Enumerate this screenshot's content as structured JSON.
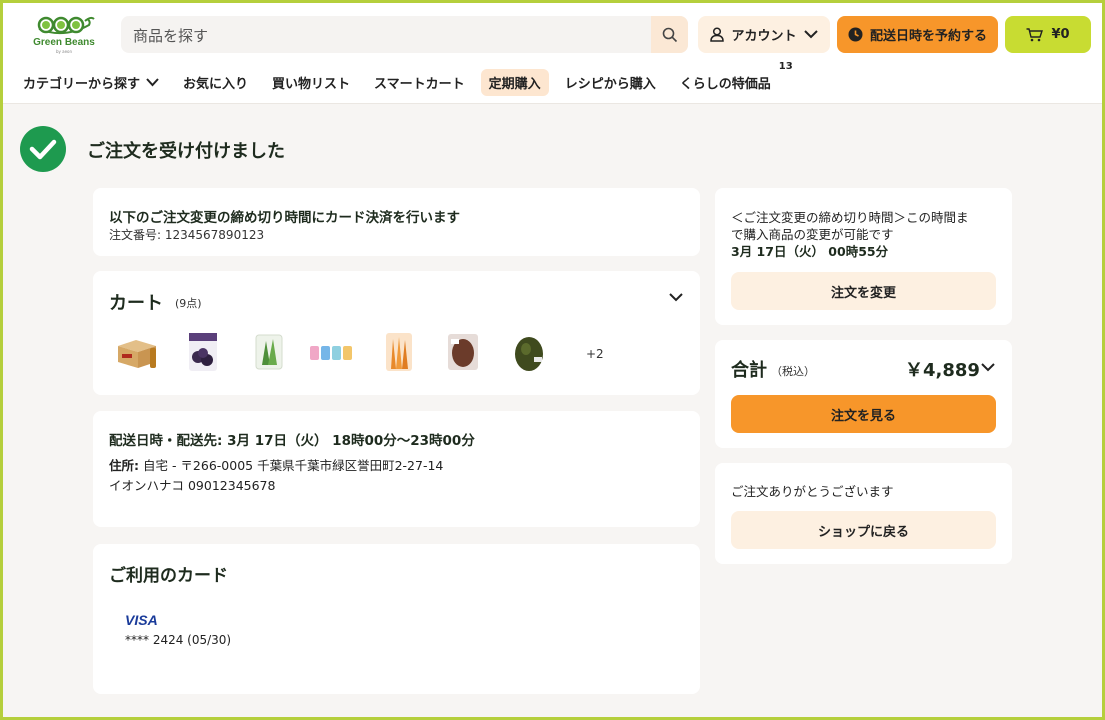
{
  "brand": {
    "name": "Green Beans",
    "sub": "by aeon"
  },
  "search": {
    "placeholder": "商品を探す"
  },
  "header": {
    "account_label": "アカウント",
    "reserve_label": "配送日時を予約する",
    "cart_total": "¥0"
  },
  "nav": {
    "items": [
      {
        "label": "カテゴリーから探す"
      },
      {
        "label": "お気に入り"
      },
      {
        "label": "買い物リスト"
      },
      {
        "label": "スマートカート"
      },
      {
        "label": "定期購入"
      },
      {
        "label": "レシピから購入"
      },
      {
        "label": "くらしの特価品",
        "badge": "13"
      }
    ]
  },
  "confirmation": {
    "title": "ご注文を受け付けました"
  },
  "notice": {
    "headline": "以下のご注文変更の締め切り時間にカード決済を行います",
    "order_number": "注文番号: 1234567890123"
  },
  "cart": {
    "title": "カート",
    "count": "(9点)",
    "more": "+2",
    "items": [
      {
        "icon": "beverage-box-icon"
      },
      {
        "icon": "snack-bag-icon"
      },
      {
        "icon": "vegetable-pack-icon"
      },
      {
        "icon": "soap-bars-icon"
      },
      {
        "icon": "carrot-bag-icon"
      },
      {
        "icon": "chocolate-pack-icon"
      },
      {
        "icon": "avocado-icon"
      }
    ]
  },
  "delivery": {
    "headline": "配送日時・配送先: 3月 17日（火） 18時00分〜23時00分",
    "address_label": "住所:",
    "address": " 自宅 - 〒266-0005 千葉県千葉市緑区誉田町2-27-14",
    "contact": "イオンハナコ 09012345678"
  },
  "payment": {
    "title": "ご利用のカード",
    "brand": "VISA",
    "masked": "**** 2424 (05/30)"
  },
  "deadline": {
    "line1": "＜ご注文変更の締め切り時間＞この時間ま",
    "line2": "で購入商品の変更が可能です",
    "datetime": "3月 17日（火） 00時55分",
    "button": "注文を変更"
  },
  "total": {
    "label": "合計",
    "tax_note": "（税込）",
    "amount": "￥4,889",
    "button": "注文を見る"
  },
  "thanks": {
    "message": "ご注文ありがとうございます",
    "button": "ショップに戻る"
  },
  "colors": {
    "accent_orange": "#f7962a",
    "accent_green": "#c8dc32",
    "success_green": "#1e9a4f",
    "soft_orange": "#fdf0e1",
    "frame_border": "#b5cf3c"
  }
}
